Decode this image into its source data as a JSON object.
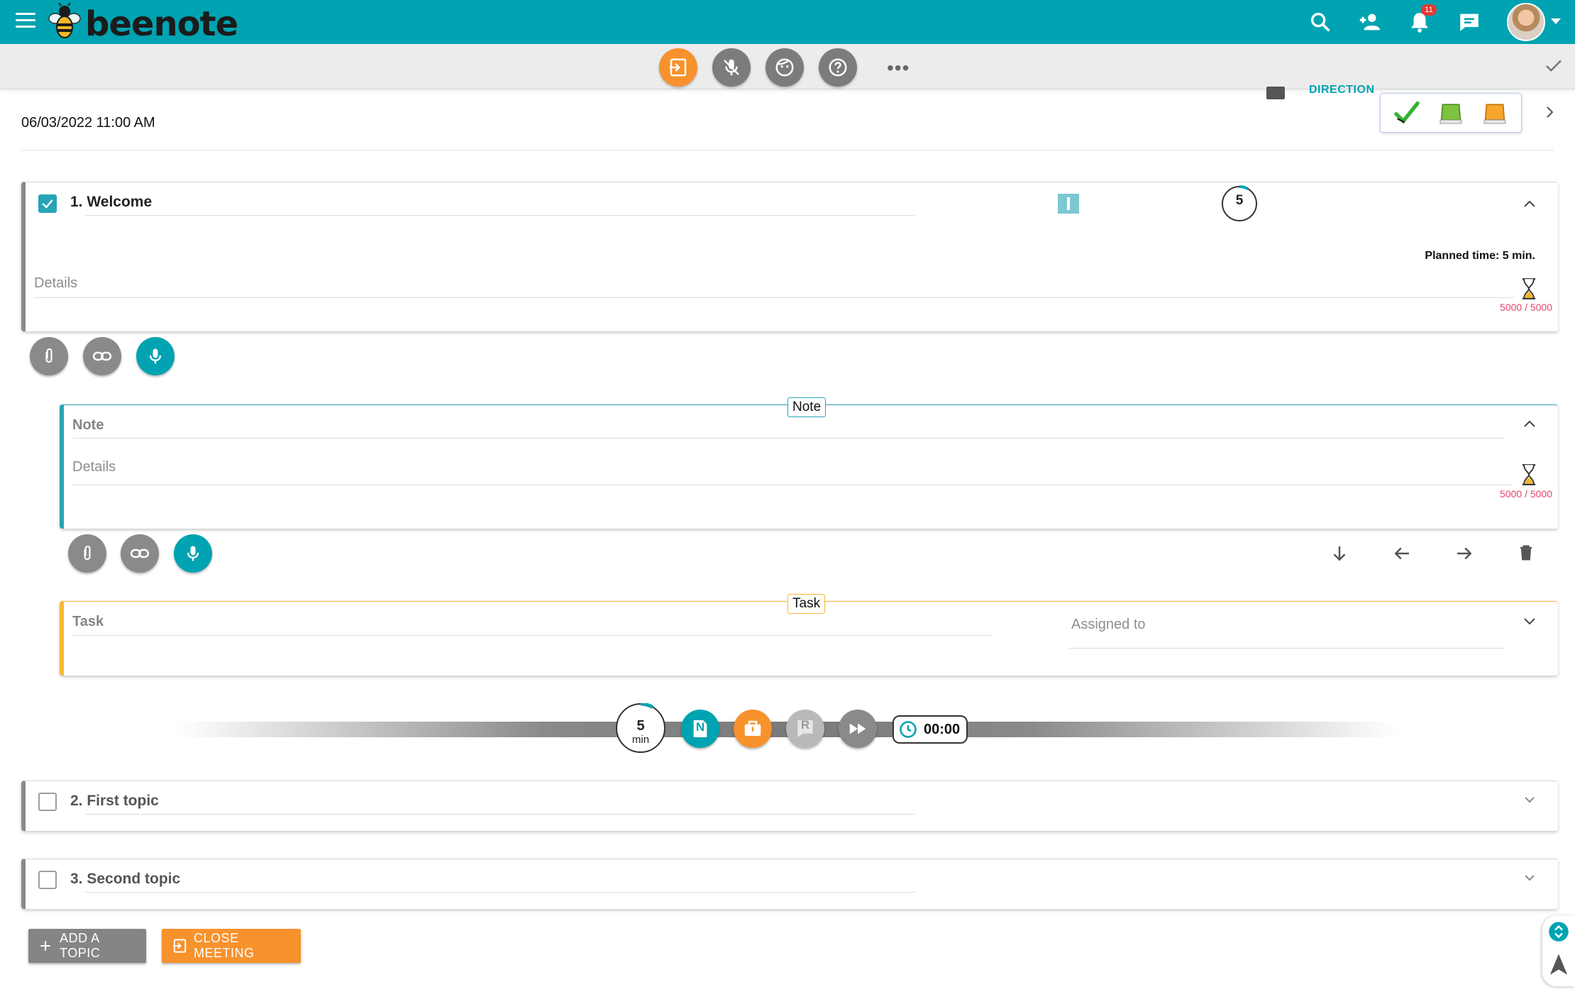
{
  "app": {
    "name": "beenote",
    "notification_count": "11"
  },
  "toolbar": {
    "more_label": "•••"
  },
  "meeting": {
    "datetime": "06/03/2022 11:00 AM",
    "direction_label": "DIRECTION"
  },
  "topics": [
    {
      "title": "1. Welcome",
      "duration": "5",
      "planned_time": "Planned time: 5 min.",
      "details_placeholder": "Details",
      "char_counter": "5000 / 5000",
      "checked": true
    },
    {
      "title": "2. First topic",
      "checked": false
    },
    {
      "title": "3. Second topic",
      "checked": false
    }
  ],
  "note": {
    "tag": "Note",
    "title_placeholder": "Note",
    "details_placeholder": "Details",
    "char_counter": "5000 / 5000"
  },
  "task": {
    "tag": "Task",
    "title_placeholder": "Task",
    "assigned_placeholder": "Assigned to"
  },
  "timeline": {
    "minutes": "5",
    "minutes_unit": "min",
    "elapsed": "00:00",
    "n_label": "N",
    "r_label": "R"
  },
  "actions": {
    "add_topic": "ADD A TOPIC",
    "close_meeting": "CLOSE MEETING"
  },
  "colors": {
    "brand": "#00a3b1",
    "accent_orange": "#f7922d",
    "counter_red": "#e0446a",
    "note_border": "#27a4b6",
    "task_border": "#f7b733"
  }
}
